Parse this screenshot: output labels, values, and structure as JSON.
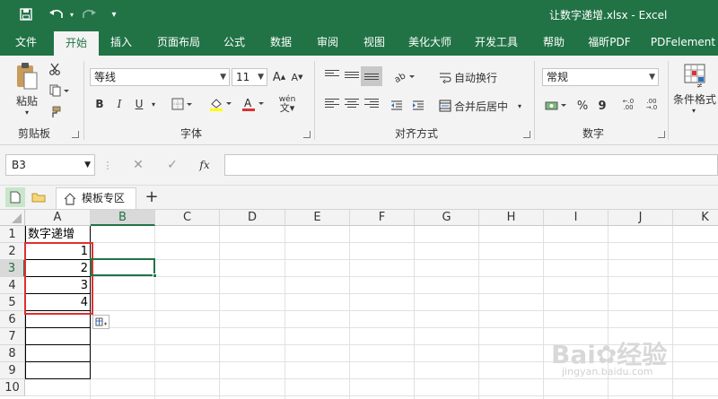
{
  "window": {
    "title": "让数字递增.xlsx  -  Excel",
    "accent": "#217346"
  },
  "tabs": [
    "文件",
    "开始",
    "插入",
    "页面布局",
    "公式",
    "数据",
    "审阅",
    "视图",
    "美化大师",
    "开发工具",
    "帮助",
    "福昕PDF",
    "PDFelement"
  ],
  "active_tab": "开始",
  "ribbon": {
    "clipboard": {
      "label": "剪贴板",
      "paste_label": "粘贴"
    },
    "font": {
      "label": "字体",
      "font_name": "等线",
      "font_size": "11",
      "bold": "B",
      "italic": "I",
      "underline": "U",
      "phonetic": "wén"
    },
    "alignment": {
      "label": "对齐方式",
      "wrap_text": "自动换行",
      "merge_center": "合并后居中"
    },
    "number": {
      "label": "数字",
      "format": "常规",
      "percent": "%",
      "comma": "9"
    },
    "styles": {
      "conditional_format": "条件格式"
    }
  },
  "formula_bar": {
    "name_box": "B3",
    "fx": "fx",
    "value": ""
  },
  "doc_tabs": {
    "template_tab": "模板专区",
    "add": "+"
  },
  "sheet": {
    "columns": [
      "A",
      "B",
      "C",
      "D",
      "E",
      "F",
      "G",
      "H",
      "I",
      "J",
      "K"
    ],
    "rows": [
      "1",
      "2",
      "3",
      "4",
      "5",
      "6",
      "7",
      "8",
      "9",
      "10"
    ],
    "selected_column": "B",
    "selected_row": "3",
    "cells": {
      "A1": "数字递增",
      "A2": "1",
      "A3": "2",
      "A4": "3",
      "A5": "4"
    },
    "highlight_color": "#e03030",
    "selection_color": "#217346"
  }
}
